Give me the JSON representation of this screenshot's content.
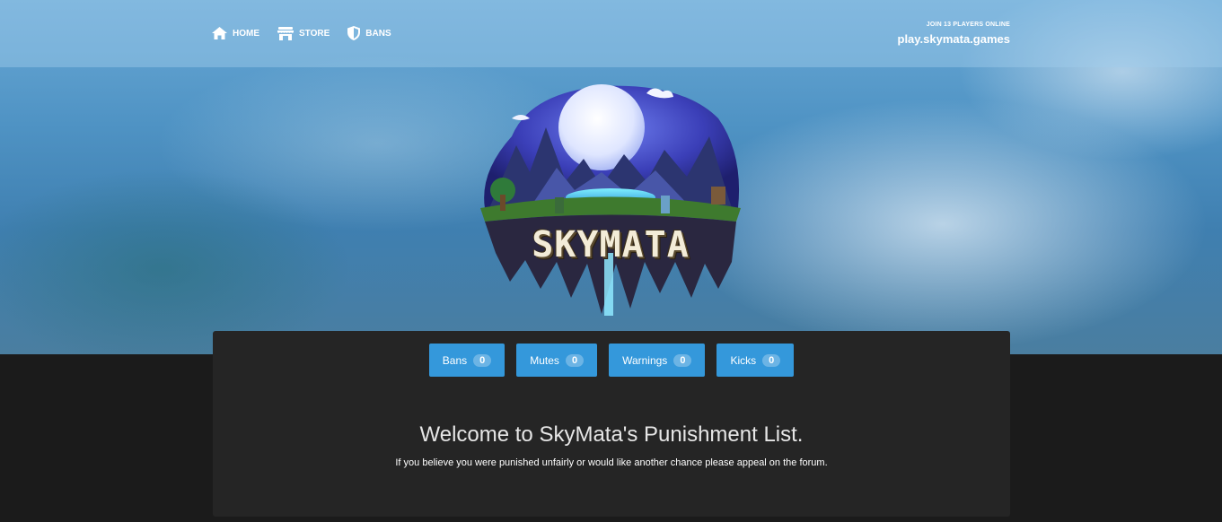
{
  "nav": {
    "items": [
      {
        "label": "HOME",
        "icon": "home-icon"
      },
      {
        "label": "STORE",
        "icon": "store-icon"
      },
      {
        "label": "BANS",
        "icon": "shield-icon"
      }
    ]
  },
  "server": {
    "online_label": "JOIN 13 PLAYERS ONLINE",
    "ip": "play.skymata.games"
  },
  "logo": {
    "text": "SKYMATA"
  },
  "tabs": [
    {
      "label": "Bans",
      "count": "0"
    },
    {
      "label": "Mutes",
      "count": "0"
    },
    {
      "label": "Warnings",
      "count": "0"
    },
    {
      "label": "Kicks",
      "count": "0"
    }
  ],
  "content": {
    "title": "Welcome to SkyMata's Punishment List.",
    "subtitle": "If you believe you were punished unfairly or would like another chance please appeal on the forum."
  },
  "colors": {
    "accent": "#3498db",
    "panel": "#252525",
    "page_bg": "#1b1b1b"
  }
}
